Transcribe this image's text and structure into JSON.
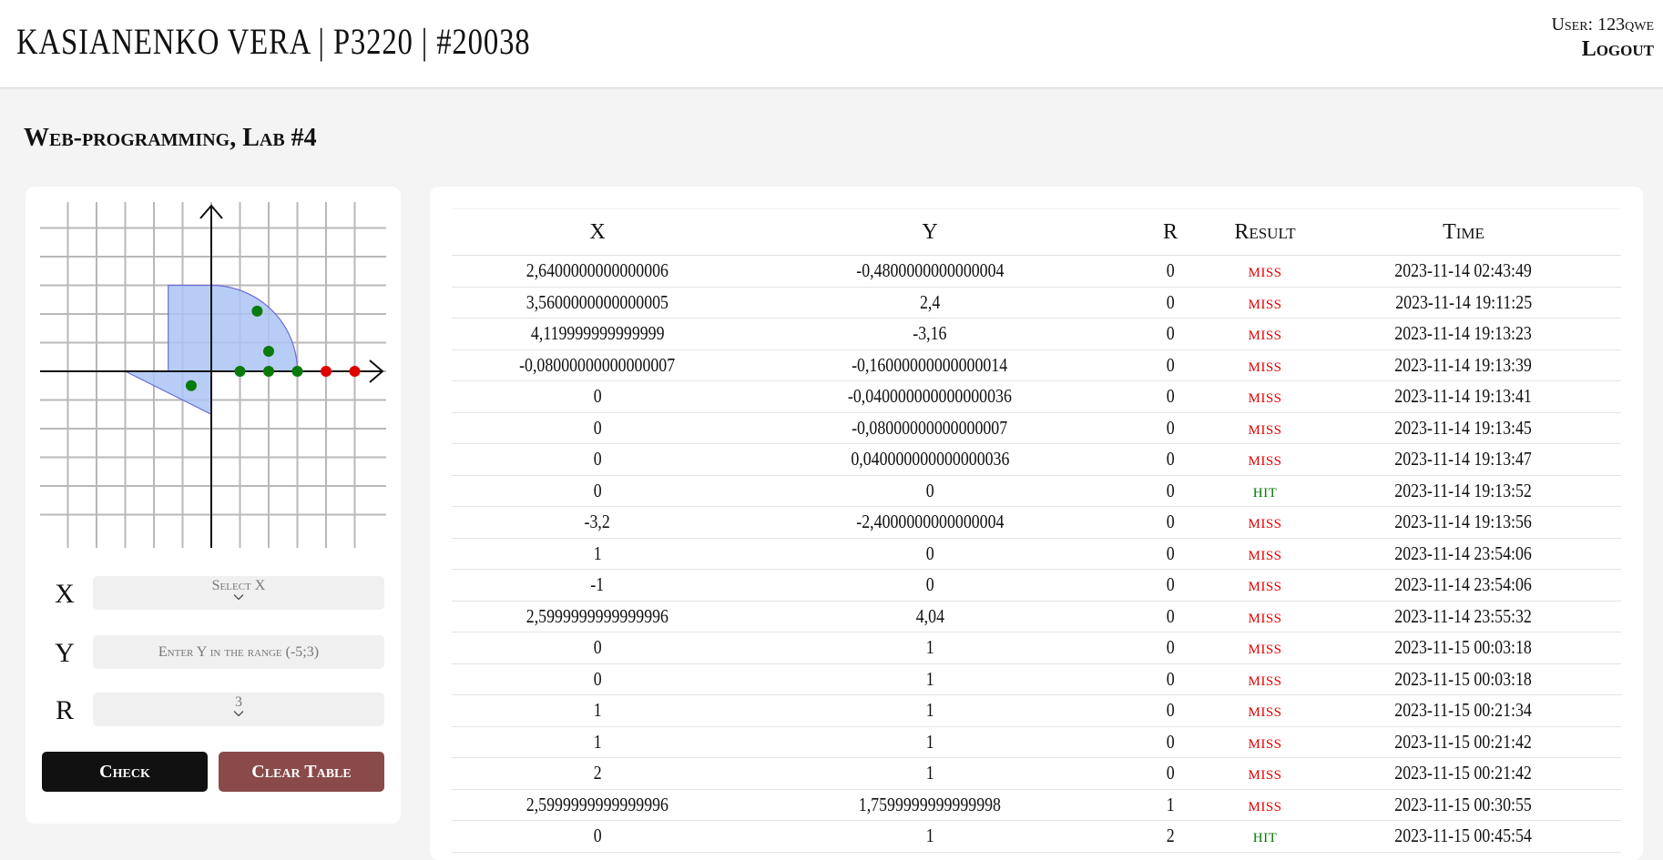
{
  "header": {
    "title": "KASIANENKO VERA | P3220 | #20038",
    "user_label": "User: 123qwe",
    "logout_label": "Logout"
  },
  "page_heading": "Web-programming, Lab #4",
  "form": {
    "x_label": "X",
    "x_placeholder": "Select X",
    "y_label": "Y",
    "y_placeholder": "Enter Y in the range (-5;3)",
    "r_label": "R",
    "r_value": "3",
    "check_label": "Check",
    "clear_label": "Clear Table"
  },
  "graph": {
    "r": 3,
    "points": [
      {
        "x": 1.6,
        "y": 2.1,
        "hit": true
      },
      {
        "x": 2.0,
        "y": 0.7,
        "hit": true
      },
      {
        "x": -0.7,
        "y": -0.5,
        "hit": true
      },
      {
        "x": 1.0,
        "y": 0,
        "hit": true
      },
      {
        "x": 2.0,
        "y": 0,
        "hit": true
      },
      {
        "x": 3.0,
        "y": 0,
        "hit": true
      },
      {
        "x": 4.0,
        "y": 0,
        "hit": false
      },
      {
        "x": 5.0,
        "y": 0,
        "hit": false
      }
    ],
    "colors": {
      "area": "#aac4f5",
      "hit": "#0a7a0a",
      "miss": "#e00000"
    }
  },
  "table": {
    "headers": [
      "X",
      "Y",
      "R",
      "Result",
      "Time"
    ],
    "rows": [
      [
        "2,6400000000000006",
        "-0,4800000000000004",
        "0",
        "miss",
        "2023-11-14 02:43:49"
      ],
      [
        "3,5600000000000005",
        "2,4",
        "0",
        "miss",
        "2023-11-14 19:11:25"
      ],
      [
        "4,119999999999999",
        "-3,16",
        "0",
        "miss",
        "2023-11-14 19:13:23"
      ],
      [
        "-0,08000000000000007",
        "-0,16000000000000014",
        "0",
        "miss",
        "2023-11-14 19:13:39"
      ],
      [
        "0",
        "-0,040000000000000036",
        "0",
        "miss",
        "2023-11-14 19:13:41"
      ],
      [
        "0",
        "-0,08000000000000007",
        "0",
        "miss",
        "2023-11-14 19:13:45"
      ],
      [
        "0",
        "0,040000000000000036",
        "0",
        "miss",
        "2023-11-14 19:13:47"
      ],
      [
        "0",
        "0",
        "0",
        "hit",
        "2023-11-14 19:13:52"
      ],
      [
        "-3,2",
        "-2,4000000000000004",
        "0",
        "miss",
        "2023-11-14 19:13:56"
      ],
      [
        "1",
        "0",
        "0",
        "miss",
        "2023-11-14 23:54:06"
      ],
      [
        "-1",
        "0",
        "0",
        "miss",
        "2023-11-14 23:54:06"
      ],
      [
        "2,5999999999999996",
        "4,04",
        "0",
        "miss",
        "2023-11-14 23:55:32"
      ],
      [
        "0",
        "1",
        "0",
        "miss",
        "2023-11-15 00:03:18"
      ],
      [
        "0",
        "1",
        "0",
        "miss",
        "2023-11-15 00:03:18"
      ],
      [
        "1",
        "1",
        "0",
        "miss",
        "2023-11-15 00:21:34"
      ],
      [
        "1",
        "1",
        "0",
        "miss",
        "2023-11-15 00:21:42"
      ],
      [
        "2",
        "1",
        "0",
        "miss",
        "2023-11-15 00:21:42"
      ],
      [
        "2,5999999999999996",
        "1,7599999999999998",
        "1",
        "miss",
        "2023-11-15 00:30:55"
      ],
      [
        "0",
        "1",
        "2",
        "hit",
        "2023-11-15 00:45:54"
      ]
    ]
  }
}
